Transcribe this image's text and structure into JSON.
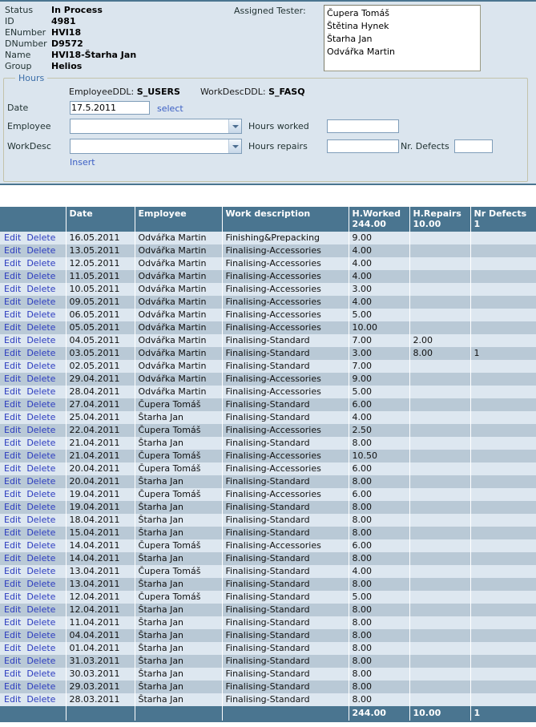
{
  "info": {
    "rows": [
      {
        "label": "Status",
        "value": "In Process"
      },
      {
        "label": "ID",
        "value": "4981"
      },
      {
        "label": "ENumber",
        "value": "HVI18"
      },
      {
        "label": "DNumber",
        "value": "D9572"
      },
      {
        "label": "Name",
        "value": "HVI18-Štarha Jan"
      },
      {
        "label": "Group",
        "value": "Helios"
      }
    ]
  },
  "tester": {
    "label": "Assigned Tester:",
    "items": [
      "Čupera Tomáš",
      "Štětina Hynek",
      "Štarha Jan",
      "Odvářka Martin"
    ]
  },
  "hours_form": {
    "legend": "Hours",
    "ddl_info_employee_label": "EmployeeDDL:",
    "ddl_info_employee_value": "S_USERS",
    "ddl_info_workdesc_label": "WorkDescDDL:",
    "ddl_info_workdesc_value": "S_FASQ",
    "date_label": "Date",
    "date_value": "17.5.2011",
    "select_link": "select",
    "employee_label": "Employee",
    "employee_value": "",
    "workdesc_label": "WorkDesc",
    "workdesc_value": "",
    "hours_worked_label": "Hours worked",
    "hours_worked_value": "",
    "hours_repairs_label": "Hours repairs",
    "hours_repairs_value": "",
    "nr_defects_label": "Nr. Defects",
    "nr_defects_value": "",
    "insert_link": "Insert"
  },
  "grid": {
    "commands": {
      "edit": "Edit",
      "delete": "Delete"
    },
    "headers": {
      "command": "",
      "date": "Date",
      "employee": "Employee",
      "work_description": "Work description",
      "hours_worked": "H.Worked",
      "hours_worked_total": "244.00",
      "hours_repairs": "H.Repairs",
      "hours_repairs_total": "10.00",
      "nr_defects": "Nr Defects",
      "nr_defects_total": "1"
    },
    "rows": [
      {
        "date": "16.05.2011",
        "employee": "Odvářka Martin",
        "desc": "Finishing&Prepacking",
        "hw": "9.00",
        "hr": "",
        "nd": ""
      },
      {
        "date": "13.05.2011",
        "employee": "Odvářka Martin",
        "desc": "Finalising-Accessories",
        "hw": "4.00",
        "hr": "",
        "nd": ""
      },
      {
        "date": "12.05.2011",
        "employee": "Odvářka Martin",
        "desc": "Finalising-Accessories",
        "hw": "4.00",
        "hr": "",
        "nd": ""
      },
      {
        "date": "11.05.2011",
        "employee": "Odvářka Martin",
        "desc": "Finalising-Accessories",
        "hw": "4.00",
        "hr": "",
        "nd": ""
      },
      {
        "date": "10.05.2011",
        "employee": "Odvářka Martin",
        "desc": "Finalising-Accessories",
        "hw": "3.00",
        "hr": "",
        "nd": ""
      },
      {
        "date": "09.05.2011",
        "employee": "Odvářka Martin",
        "desc": "Finalising-Accessories",
        "hw": "4.00",
        "hr": "",
        "nd": ""
      },
      {
        "date": "06.05.2011",
        "employee": "Odvářka Martin",
        "desc": "Finalising-Accessories",
        "hw": "5.00",
        "hr": "",
        "nd": ""
      },
      {
        "date": "05.05.2011",
        "employee": "Odvářka Martin",
        "desc": "Finalising-Accessories",
        "hw": "10.00",
        "hr": "",
        "nd": ""
      },
      {
        "date": "04.05.2011",
        "employee": "Odvářka Martin",
        "desc": "Finalising-Standard",
        "hw": "7.00",
        "hr": "2.00",
        "nd": ""
      },
      {
        "date": "03.05.2011",
        "employee": "Odvářka Martin",
        "desc": "Finalising-Standard",
        "hw": "3.00",
        "hr": "8.00",
        "nd": "1"
      },
      {
        "date": "02.05.2011",
        "employee": "Odvářka Martin",
        "desc": "Finalising-Standard",
        "hw": "7.00",
        "hr": "",
        "nd": ""
      },
      {
        "date": "29.04.2011",
        "employee": "Odvářka Martin",
        "desc": "Finalising-Accessories",
        "hw": "9.00",
        "hr": "",
        "nd": ""
      },
      {
        "date": "28.04.2011",
        "employee": "Odvářka Martin",
        "desc": "Finalising-Accessories",
        "hw": "5.00",
        "hr": "",
        "nd": ""
      },
      {
        "date": "27.04.2011",
        "employee": "Čupera Tomáš",
        "desc": "Finalising-Standard",
        "hw": "6.00",
        "hr": "",
        "nd": ""
      },
      {
        "date": "25.04.2011",
        "employee": "Štarha Jan",
        "desc": "Finalising-Standard",
        "hw": "4.00",
        "hr": "",
        "nd": ""
      },
      {
        "date": "22.04.2011",
        "employee": "Čupera Tomáš",
        "desc": "Finalising-Accessories",
        "hw": "2.50",
        "hr": "",
        "nd": ""
      },
      {
        "date": "21.04.2011",
        "employee": "Štarha Jan",
        "desc": "Finalising-Standard",
        "hw": "8.00",
        "hr": "",
        "nd": ""
      },
      {
        "date": "21.04.2011",
        "employee": "Čupera Tomáš",
        "desc": "Finalising-Accessories",
        "hw": "10.50",
        "hr": "",
        "nd": ""
      },
      {
        "date": "20.04.2011",
        "employee": "Čupera Tomáš",
        "desc": "Finalising-Accessories",
        "hw": "6.00",
        "hr": "",
        "nd": ""
      },
      {
        "date": "20.04.2011",
        "employee": "Štarha Jan",
        "desc": "Finalising-Standard",
        "hw": "8.00",
        "hr": "",
        "nd": ""
      },
      {
        "date": "19.04.2011",
        "employee": "Čupera Tomáš",
        "desc": "Finalising-Accessories",
        "hw": "6.00",
        "hr": "",
        "nd": ""
      },
      {
        "date": "19.04.2011",
        "employee": "Štarha Jan",
        "desc": "Finalising-Standard",
        "hw": "8.00",
        "hr": "",
        "nd": ""
      },
      {
        "date": "18.04.2011",
        "employee": "Štarha Jan",
        "desc": "Finalising-Standard",
        "hw": "8.00",
        "hr": "",
        "nd": ""
      },
      {
        "date": "15.04.2011",
        "employee": "Štarha Jan",
        "desc": "Finalising-Standard",
        "hw": "8.00",
        "hr": "",
        "nd": ""
      },
      {
        "date": "14.04.2011",
        "employee": "Čupera Tomáš",
        "desc": "Finalising-Accessories",
        "hw": "6.00",
        "hr": "",
        "nd": ""
      },
      {
        "date": "14.04.2011",
        "employee": "Štarha Jan",
        "desc": "Finalising-Standard",
        "hw": "8.00",
        "hr": "",
        "nd": ""
      },
      {
        "date": "13.04.2011",
        "employee": "Čupera Tomáš",
        "desc": "Finalising-Standard",
        "hw": "4.00",
        "hr": "",
        "nd": ""
      },
      {
        "date": "13.04.2011",
        "employee": "Štarha Jan",
        "desc": "Finalising-Standard",
        "hw": "8.00",
        "hr": "",
        "nd": ""
      },
      {
        "date": "12.04.2011",
        "employee": "Čupera Tomáš",
        "desc": "Finalising-Standard",
        "hw": "5.00",
        "hr": "",
        "nd": ""
      },
      {
        "date": "12.04.2011",
        "employee": "Štarha Jan",
        "desc": "Finalising-Standard",
        "hw": "8.00",
        "hr": "",
        "nd": ""
      },
      {
        "date": "11.04.2011",
        "employee": "Štarha Jan",
        "desc": "Finalising-Standard",
        "hw": "8.00",
        "hr": "",
        "nd": ""
      },
      {
        "date": "04.04.2011",
        "employee": "Štarha Jan",
        "desc": "Finalising-Standard",
        "hw": "8.00",
        "hr": "",
        "nd": ""
      },
      {
        "date": "01.04.2011",
        "employee": "Štarha Jan",
        "desc": "Finalising-Standard",
        "hw": "8.00",
        "hr": "",
        "nd": ""
      },
      {
        "date": "31.03.2011",
        "employee": "Štarha Jan",
        "desc": "Finalising-Standard",
        "hw": "8.00",
        "hr": "",
        "nd": ""
      },
      {
        "date": "30.03.2011",
        "employee": "Štarha Jan",
        "desc": "Finalising-Standard",
        "hw": "8.00",
        "hr": "",
        "nd": ""
      },
      {
        "date": "29.03.2011",
        "employee": "Štarha Jan",
        "desc": "Finalising-Standard",
        "hw": "8.00",
        "hr": "",
        "nd": ""
      },
      {
        "date": "28.03.2011",
        "employee": "Štarha Jan",
        "desc": "Finalising-Standard",
        "hw": "8.00",
        "hr": "",
        "nd": ""
      }
    ],
    "footer": {
      "hw": "244.00",
      "hr": "10.00",
      "nd": "1"
    }
  },
  "colors": {
    "header_blue": "#4a7590",
    "panel_bg": "#dbe5ee",
    "row_odd": "#dde7f0",
    "row_even": "#b9c9d6",
    "link": "#2b3bbf"
  }
}
